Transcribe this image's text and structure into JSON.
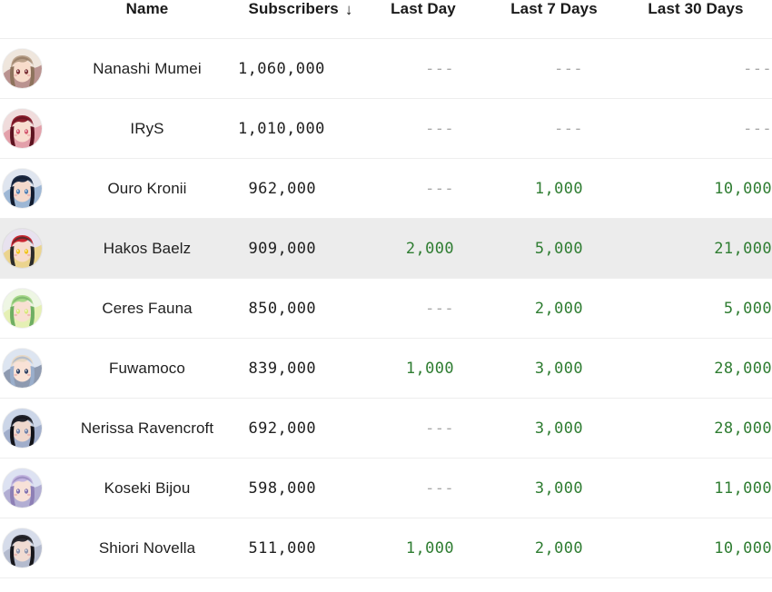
{
  "table": {
    "columns": [
      {
        "key": "avatar",
        "label": "",
        "name": "column-avatar"
      },
      {
        "key": "name",
        "label": "Name",
        "name": "column-name"
      },
      {
        "key": "subs",
        "label": "Subscribers",
        "name": "column-subscribers",
        "sorted": true,
        "sort_icon": "arrow-down-icon",
        "sort_glyph": "↓"
      },
      {
        "key": "day",
        "label": "Last Day",
        "name": "column-last-day"
      },
      {
        "key": "week",
        "label": "Last 7 Days",
        "name": "column-last-7-days"
      },
      {
        "key": "month",
        "label": "Last 30 Days",
        "name": "column-last-30-days"
      }
    ],
    "empty_value": "---",
    "colors": {
      "positive": "#2f7d32",
      "empty": "#a8a8a8",
      "row_highlight": "#ececec",
      "row_divider": "#eeeeee",
      "text": "#1f1f1f"
    },
    "rows": [
      {
        "name": "Nanashi Mumei",
        "subscribers": "1,060,000",
        "last_day": "---",
        "last_7_days": "---",
        "last_30_days": "---",
        "highlighted": false,
        "avatar": {
          "name": "avatar-nanashi-mumei",
          "hair": "#b9a089",
          "hair_dark": "#8d735c",
          "skin": "#f7dccb",
          "bg": "#efe6dd",
          "accent": "#7a2f34"
        }
      },
      {
        "name": "IRyS",
        "subscribers": "1,010,000",
        "last_day": "---",
        "last_7_days": "---",
        "last_30_days": "---",
        "highlighted": false,
        "avatar": {
          "name": "avatar-irys",
          "hair": "#8c1f2d",
          "hair_dark": "#5d1320",
          "skin": "#f8ddd0",
          "bg": "#f0dcdc",
          "accent": "#d3566c"
        }
      },
      {
        "name": "Ouro Kronii",
        "subscribers": "962,000",
        "last_day": "---",
        "last_7_days": "1,000",
        "last_30_days": "10,000",
        "highlighted": false,
        "avatar": {
          "name": "avatar-ouro-kronii",
          "hair": "#1d2b45",
          "hair_dark": "#111b2e",
          "skin": "#f3d9cc",
          "bg": "#dfe5ef",
          "accent": "#4d7fb5"
        }
      },
      {
        "name": "Hakos Baelz",
        "subscribers": "909,000",
        "last_day": "2,000",
        "last_7_days": "5,000",
        "last_30_days": "21,000",
        "highlighted": true,
        "avatar": {
          "name": "avatar-hakos-baelz",
          "hair": "#c92531",
          "hair_dark": "#2b2b2b",
          "skin": "#f7dccd",
          "bg": "#e8e2ef",
          "accent": "#f0c419"
        }
      },
      {
        "name": "Ceres Fauna",
        "subscribers": "850,000",
        "last_day": "---",
        "last_7_days": "2,000",
        "last_30_days": "5,000",
        "highlighted": false,
        "avatar": {
          "name": "avatar-ceres-fauna",
          "hair": "#a8d88a",
          "hair_dark": "#6fae62",
          "skin": "#f8e0d2",
          "bg": "#eef6e4",
          "accent": "#d9e87a"
        }
      },
      {
        "name": "Fuwamoco",
        "subscribers": "839,000",
        "last_day": "1,000",
        "last_7_days": "3,000",
        "last_30_days": "28,000",
        "highlighted": false,
        "avatar": {
          "name": "avatar-fuwamoco",
          "hair": "#e8d9c5",
          "hair_dark": "#9aaecb",
          "skin": "#f9e2d6",
          "bg": "#dde5f1",
          "accent": "#2e3f62"
        }
      },
      {
        "name": "Nerissa Ravencroft",
        "subscribers": "692,000",
        "last_day": "---",
        "last_7_days": "3,000",
        "last_30_days": "28,000",
        "highlighted": false,
        "avatar": {
          "name": "avatar-nerissa-ravencroft",
          "hair": "#23242c",
          "hair_dark": "#121318",
          "skin": "#efd8cd",
          "bg": "#ccd6e8",
          "accent": "#6c7fa8"
        }
      },
      {
        "name": "Koseki Bijou",
        "subscribers": "598,000",
        "last_day": "---",
        "last_7_days": "3,000",
        "last_30_days": "11,000",
        "highlighted": false,
        "avatar": {
          "name": "avatar-koseki-bijou",
          "hair": "#c3b6e0",
          "hair_dark": "#8d7fb5",
          "skin": "#f7e1d8",
          "bg": "#dde2f2",
          "accent": "#7f6fae"
        }
      },
      {
        "name": "Shiori Novella",
        "subscribers": "511,000",
        "last_day": "1,000",
        "last_7_days": "2,000",
        "last_30_days": "10,000",
        "highlighted": false,
        "avatar": {
          "name": "avatar-shiori-novella",
          "hair": "#2c2c33",
          "hair_dark": "#17171c",
          "skin": "#f0dbd2",
          "bg": "#d6dcea",
          "accent": "#8b93ad"
        }
      }
    ]
  }
}
